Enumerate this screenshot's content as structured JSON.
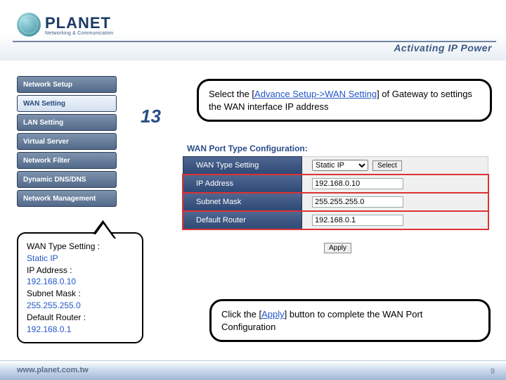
{
  "brand": {
    "name": "PLANET",
    "tagline": "Networking & Communication",
    "slogan": "Activating IP Power"
  },
  "footer": {
    "url": "www.planet.com.tw",
    "page": "9"
  },
  "step_number": "13",
  "menu": {
    "items": [
      {
        "label": "Network Setup"
      },
      {
        "label": "WAN Setting"
      },
      {
        "label": "LAN Setting"
      },
      {
        "label": "Virtual Server"
      },
      {
        "label": "Network Filter"
      },
      {
        "label": "Dynamic DNS/DNS"
      },
      {
        "label": "Network Management"
      }
    ],
    "active_index": 1
  },
  "callout_top": {
    "part1": "Select the [",
    "linktext": "Advance Setup->WAN Setting",
    "part2": "] of Gateway to settings the WAN interface IP address"
  },
  "panel": {
    "title": "WAN Port Type Configuration:",
    "wan_type_label": "WAN Type Setting",
    "wan_type_value": "Static IP",
    "select_btn": "Select",
    "rows": [
      {
        "label": "IP Address",
        "value": "192.168.0.10"
      },
      {
        "label": "Subnet Mask",
        "value": "255.255.255.0"
      },
      {
        "label": "Default Router",
        "value": "192.168.0.1"
      }
    ],
    "apply_btn": "Apply"
  },
  "speech": {
    "l1a": "WAN Type Setting :",
    "l1b": "Static IP",
    "l2a": "IP Address :",
    "l2b": "192.168.0.10",
    "l3a": "Subnet Mask :",
    "l3b": "255.255.255.0",
    "l4a": "Default Router :",
    "l4b": "192.168.0.1"
  },
  "callout_bot": {
    "part1": "Click the [",
    "linktext": "Apply",
    "part2": "] button to complete the WAN Port Configuration"
  }
}
